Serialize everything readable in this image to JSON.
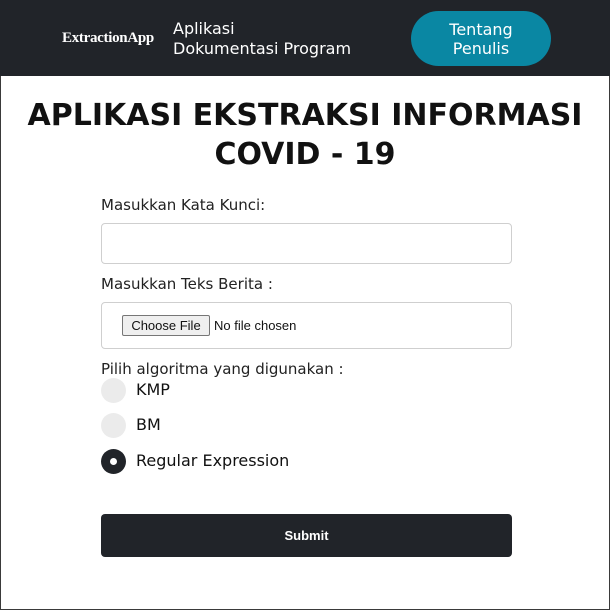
{
  "navbar": {
    "brand": "ExtractionApp",
    "title_line1": "Aplikasi",
    "title_line2": "Dokumentasi Program",
    "about_button": "Tentang Penulis"
  },
  "page": {
    "title": "APLIKASI EKSTRAKSI INFORMASI COVID - 19"
  },
  "form": {
    "keyword_label": "Masukkan Kata Kunci:",
    "keyword_value": "",
    "news_label": "Masukkan Teks Berita :",
    "file_button": "Choose File",
    "file_status": "No file chosen",
    "algo_label": "Pilih algoritma yang digunakan :",
    "options": [
      {
        "label": "KMP",
        "checked": false
      },
      {
        "label": "BM",
        "checked": false
      },
      {
        "label": "Regular Expression",
        "checked": true
      }
    ],
    "submit_label": "Submit"
  },
  "colors": {
    "navbar_bg": "#212429",
    "accent": "#0a87a3"
  }
}
